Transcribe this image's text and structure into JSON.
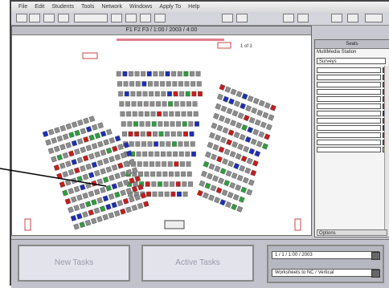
{
  "menubar": {
    "items": [
      "File",
      "Edit",
      "Students",
      "Tools",
      "Network",
      "Windows",
      "Apply To",
      "Help",
      "Help"
    ]
  },
  "document": {
    "title": "F1 F2 F3 / 1:00 / 2003 / 4:00",
    "page_label": "1 of 1"
  },
  "panel": {
    "header": "Seats",
    "label": "MultiMedia Station",
    "select_value": "Surveys",
    "rows": [
      "",
      "",
      "",
      "",
      "",
      "",
      "",
      "",
      "",
      "",
      "",
      ""
    ],
    "row_colors": [
      "#cc2222",
      "#cc2222",
      "#cc2222",
      "#cc2222",
      "#cc2222",
      "#cc2222",
      "#1a2eb8",
      "#cc2222",
      "#1a2eb8",
      "#cc2222",
      "#cc2222",
      "#e8c800"
    ],
    "footer": "Options"
  },
  "tasks": {
    "new_tasks": "New Tasks",
    "active_tasks": "Active Tasks",
    "info_top": "1 / 1 / 1:00 / 2003",
    "info_bottom": "Worksheets to NC / Vertical"
  },
  "colors": {
    "red": "#c41d1d",
    "blue": "#1d2fb3",
    "green": "#2f9c3f",
    "gray": "#8c8c8c"
  }
}
